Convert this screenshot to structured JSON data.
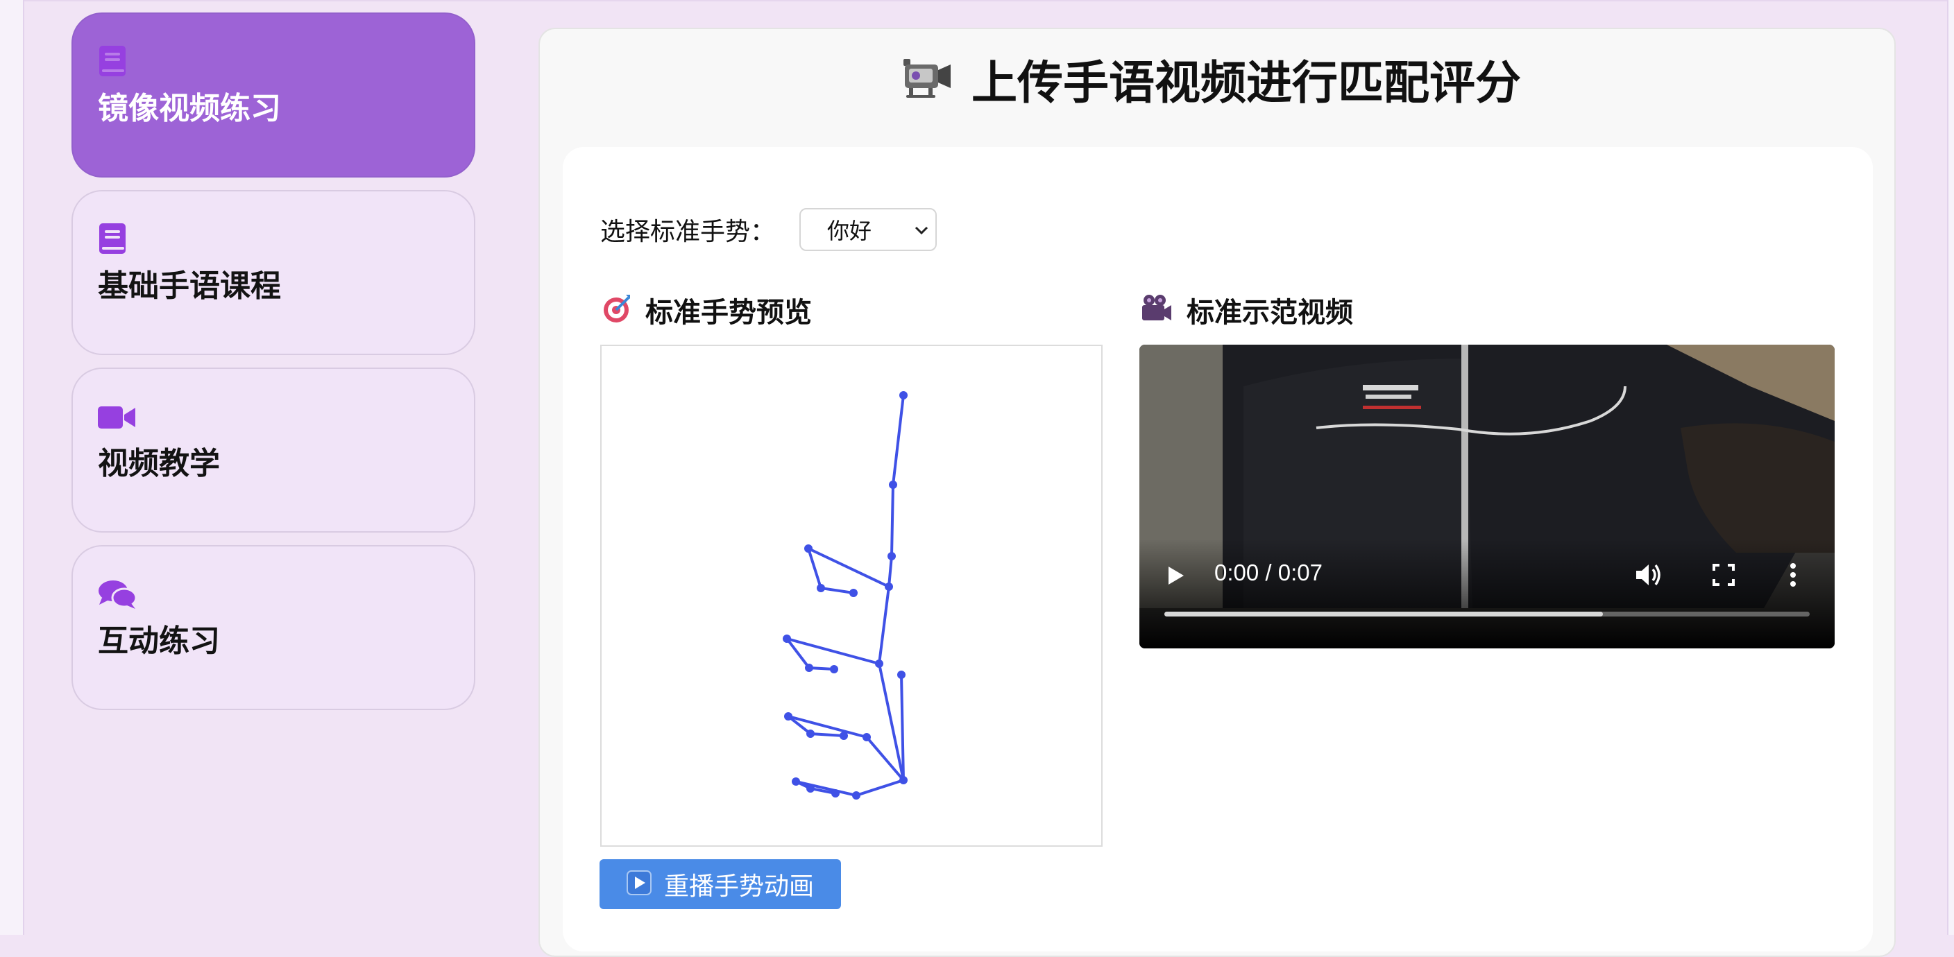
{
  "sidebar": {
    "items": [
      {
        "label": "镜像视频练习",
        "icon": "book-icon",
        "active": true
      },
      {
        "label": "基础手语课程",
        "icon": "book-icon",
        "active": false
      },
      {
        "label": "视频教学",
        "icon": "video-camera-icon",
        "active": false
      },
      {
        "label": "互动练习",
        "icon": "chat-bubbles-icon",
        "active": false
      }
    ]
  },
  "main": {
    "title": "上传手语视频进行匹配评分",
    "title_icon": "video-camera-icon",
    "select_label": "选择标准手势：",
    "selected_gesture": "你好",
    "preview_heading": "标准手势预览",
    "preview_icon": "target-icon",
    "video_heading": "标准示范视频",
    "video_icon": "movie-camera-icon",
    "replay_label": "重播手势动画",
    "replay_icon": "play-icon"
  },
  "video": {
    "time": "0:00 / 0:07",
    "progress": 0.68
  },
  "colors": {
    "accent_purple": "#9d63d6",
    "icon_purple": "#9640e0",
    "skeleton_blue": "#3f51e6",
    "button_blue": "#4a8be7",
    "page_bg": "#f1e4f5"
  }
}
